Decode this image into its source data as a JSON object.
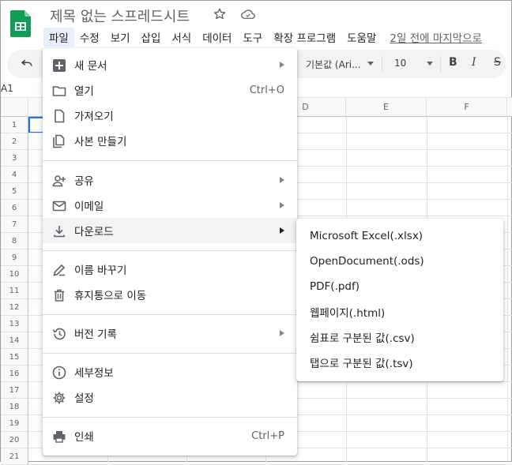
{
  "header": {
    "title": "제목 없는 스프레드시트",
    "menus": [
      "파일",
      "수정",
      "보기",
      "삽입",
      "서식",
      "데이터",
      "도구",
      "확장 프로그램",
      "도움말"
    ],
    "last_edit": "2일 전에 마지막으로"
  },
  "toolbar": {
    "font": "기본값 (Ari...",
    "size": "10",
    "bold": "B",
    "italic": "I",
    "strike": "S"
  },
  "namebox": "A1",
  "grid": {
    "columns": [
      "D",
      "E",
      "F"
    ],
    "rows": [
      "1",
      "2",
      "3",
      "4",
      "5",
      "6",
      "7",
      "8",
      "9",
      "10",
      "11",
      "12",
      "13",
      "14",
      "15",
      "16",
      "17",
      "18",
      "19",
      "20",
      "21"
    ]
  },
  "file_menu": {
    "items": [
      {
        "label": "새 문서",
        "shortcut": "",
        "icon": "new-sheet-icon"
      },
      {
        "label": "열기",
        "shortcut": "Ctrl+O",
        "icon": "folder-icon"
      },
      {
        "label": "가져오기",
        "shortcut": "",
        "icon": "file-icon"
      },
      {
        "label": "사본 만들기",
        "shortcut": "",
        "icon": "copy-icon"
      },
      {
        "label": "공유",
        "shortcut": "",
        "icon": "person-add-icon"
      },
      {
        "label": "이메일",
        "shortcut": "",
        "icon": "email-icon"
      },
      {
        "label": "다운로드",
        "shortcut": "",
        "icon": "download-icon"
      },
      {
        "label": "이름 바꾸기",
        "shortcut": "",
        "icon": "rename-icon"
      },
      {
        "label": "휴지통으로 이동",
        "shortcut": "",
        "icon": "trash-icon"
      },
      {
        "label": "버전 기록",
        "shortcut": "",
        "icon": "history-icon"
      },
      {
        "label": "세부정보",
        "shortcut": "",
        "icon": "info-icon"
      },
      {
        "label": "설정",
        "shortcut": "",
        "icon": "gear-icon"
      },
      {
        "label": "인쇄",
        "shortcut": "Ctrl+P",
        "icon": "print-icon"
      }
    ]
  },
  "download_submenu": {
    "items": [
      "Microsoft Excel(.xlsx)",
      "OpenDocument(.ods)",
      "PDF(.pdf)",
      "웹페이지(.html)",
      "쉼표로 구분된 값(.csv)",
      "탭으로 구분된 값(.tsv)"
    ]
  }
}
